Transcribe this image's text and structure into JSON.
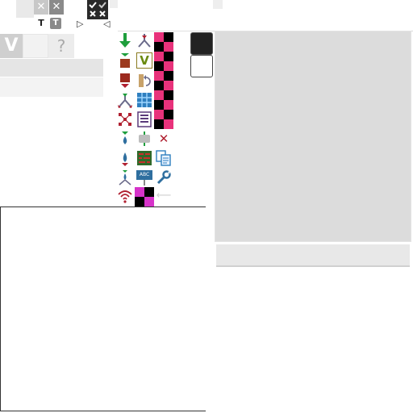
{
  "toolbar": {
    "close_a": "✕",
    "close_b": "✕",
    "text_a": "T",
    "text_b": "T",
    "play_right": "▷",
    "play_left": "◁"
  },
  "left_panel": {
    "v_label": "V",
    "help_label": "?"
  },
  "tools": {
    "validation_label": "V",
    "abc_label": "ABC",
    "close_x": "✕",
    "arrow_left": "⟵"
  },
  "colors": {
    "dark_swatch": "#222222",
    "light_swatch": "#ffffff",
    "panel_bg": "#dcdcdc",
    "accent_green": "#1e9e3c",
    "accent_red": "#b02030",
    "accent_blue": "#2f6f9f"
  }
}
